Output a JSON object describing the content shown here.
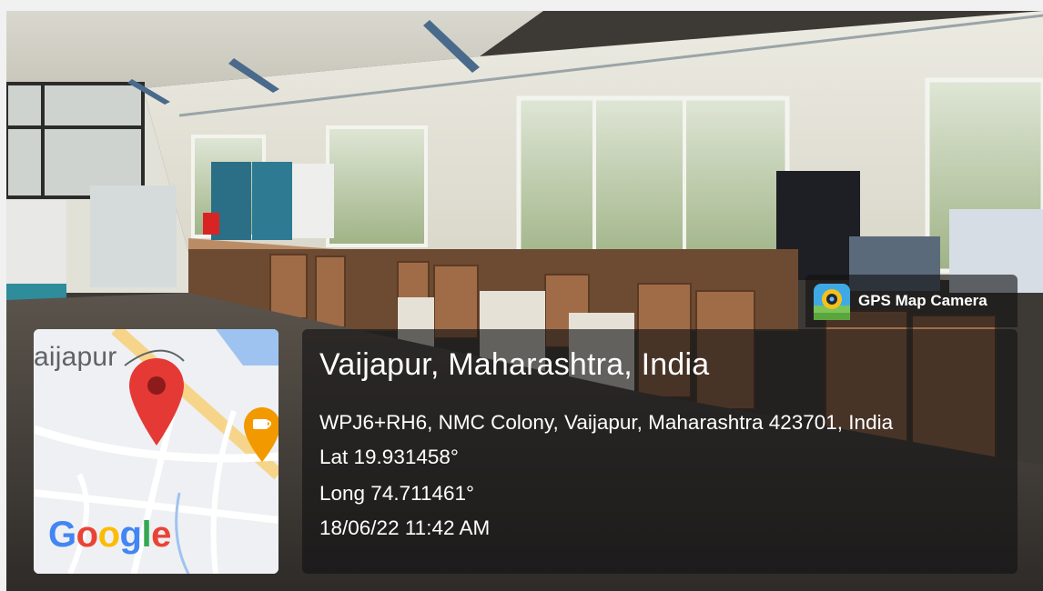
{
  "map": {
    "place_label": "aijapur",
    "google_logo_letters": [
      {
        "ch": "G",
        "color": "#4285F4"
      },
      {
        "ch": "o",
        "color": "#EA4335"
      },
      {
        "ch": "o",
        "color": "#FBBC05"
      },
      {
        "ch": "g",
        "color": "#4285F4"
      },
      {
        "ch": "l",
        "color": "#34A853"
      },
      {
        "ch": "e",
        "color": "#EA4335"
      }
    ],
    "pin_color": "#E53935",
    "poi_color": "#F29900",
    "poi_icon": "coffee-cup-icon"
  },
  "location": {
    "title": "Vaijapur, Maharashtra, India",
    "address": "WPJ6+RH6, NMC Colony, Vaijapur, Maharashtra 423701, India",
    "lat": "Lat 19.931458°",
    "long": "Long 74.711461°",
    "datetime": "18/06/22 11:42 AM"
  },
  "badge": {
    "label": "GPS Map Camera",
    "icon": "gps-camera-app-icon"
  }
}
